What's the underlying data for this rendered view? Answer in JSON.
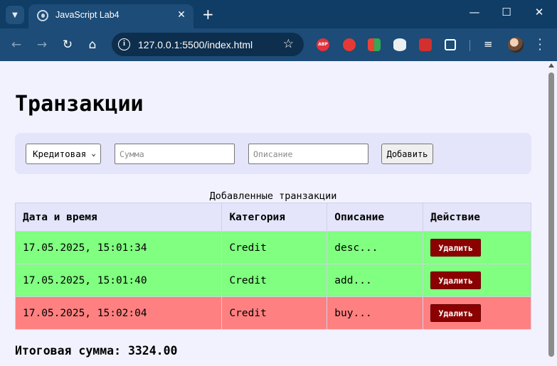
{
  "browser": {
    "tab_title": "JavaScript Lab4",
    "url": "127.0.0.1:5500/index.html",
    "theme_color": "#0f3d66",
    "extensions": [
      "adblock-plus-icon",
      "stop-hand-icon",
      "grid-app-icon",
      "database-icon",
      "record-icon",
      "extensions-puzzle-icon",
      "media-controls-icon"
    ],
    "abp_label": "ABP"
  },
  "page": {
    "title": "Транзакции",
    "form": {
      "type_selected": "Кредитовая",
      "amount_placeholder": "Сумма",
      "description_placeholder": "Описание",
      "add_label": "Добавить"
    },
    "table_caption": "Добавленные транзакции",
    "columns": [
      "Дата и время",
      "Категория",
      "Описание",
      "Действие"
    ],
    "rows": [
      {
        "datetime": "17.05.2025, 15:01:34",
        "category": "Credit",
        "description": "desc...",
        "action": "Удалить",
        "status_color": "#80ff80"
      },
      {
        "datetime": "17.05.2025, 15:01:40",
        "category": "Credit",
        "description": "add...",
        "action": "Удалить",
        "status_color": "#80ff80"
      },
      {
        "datetime": "17.05.2025, 15:02:04",
        "category": "Credit",
        "description": "buy...",
        "action": "Удалить",
        "status_color": "#ff8080"
      }
    ],
    "total": "Итоговая сумма: 3324.00",
    "colors": {
      "background": "#f2f2fe",
      "panel": "#e4e4fa",
      "delete": "#8b0000"
    }
  }
}
